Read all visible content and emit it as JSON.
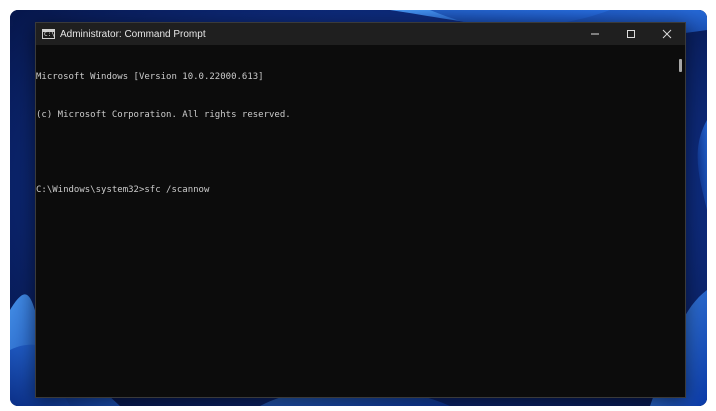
{
  "window": {
    "title": "Administrator: Command Prompt",
    "icon": "command-prompt-icon",
    "icon_glyph": "C:\\"
  },
  "controls": {
    "minimize": "minimize-icon",
    "maximize": "maximize-icon",
    "close": "close-icon"
  },
  "console": {
    "lines": [
      "Microsoft Windows [Version 10.0.22000.613]",
      "(c) Microsoft Corporation. All rights reserved.",
      "",
      "C:\\Windows\\system32>sfc /scannow"
    ]
  },
  "colors": {
    "console_background": "#0c0c0c",
    "console_text": "#cccccc",
    "titlebar": "#1f1f1f",
    "wallpaper": "#0a1f55"
  }
}
